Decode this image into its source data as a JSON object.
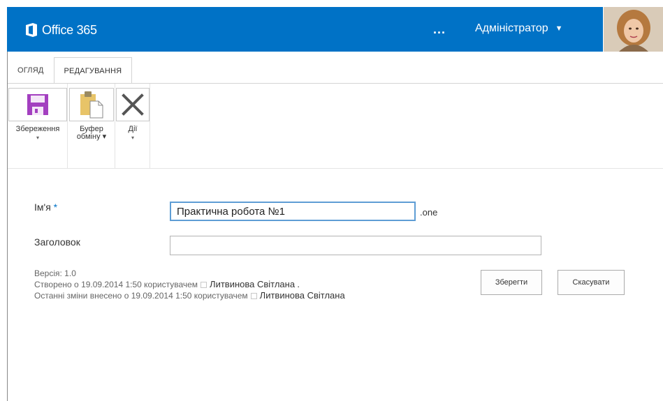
{
  "suitebar": {
    "brand": "Office 365",
    "more_label": "...",
    "user_name": "Адміністратор",
    "user_caret": "▼",
    "accent": "#0072c6"
  },
  "tabs": [
    {
      "label": "ОГЛЯД",
      "active": false
    },
    {
      "label": "РЕДАГУВАННЯ",
      "active": true
    }
  ],
  "ribbon": {
    "save_label": "Збереження",
    "clipboard_label_1": "Буфер",
    "clipboard_label_2": "обміну",
    "actions_label": "Дії",
    "dropdown_arrow": "▾",
    "icons": [
      "save-icon",
      "clipboard-icon",
      "delete-icon"
    ]
  },
  "form": {
    "name_label": "Ім'я",
    "required_mark": "*",
    "name_value": "Практична робота №1",
    "extension": ".one",
    "title_label": "Заголовок",
    "title_value": ""
  },
  "meta": {
    "version": "Версія: 1.0",
    "created_prefix": "Створено о 19.09.2014 1:50  користувачем",
    "created_author": "Литвинова Світлана",
    "created_suffix": ".",
    "modified_prefix": "Останні зміни внесено о 19.09.2014 1:50  користувачем",
    "modified_author": "Литвинова Світлана"
  },
  "buttons": {
    "save": "Зберегти",
    "cancel": "Скасувати"
  }
}
